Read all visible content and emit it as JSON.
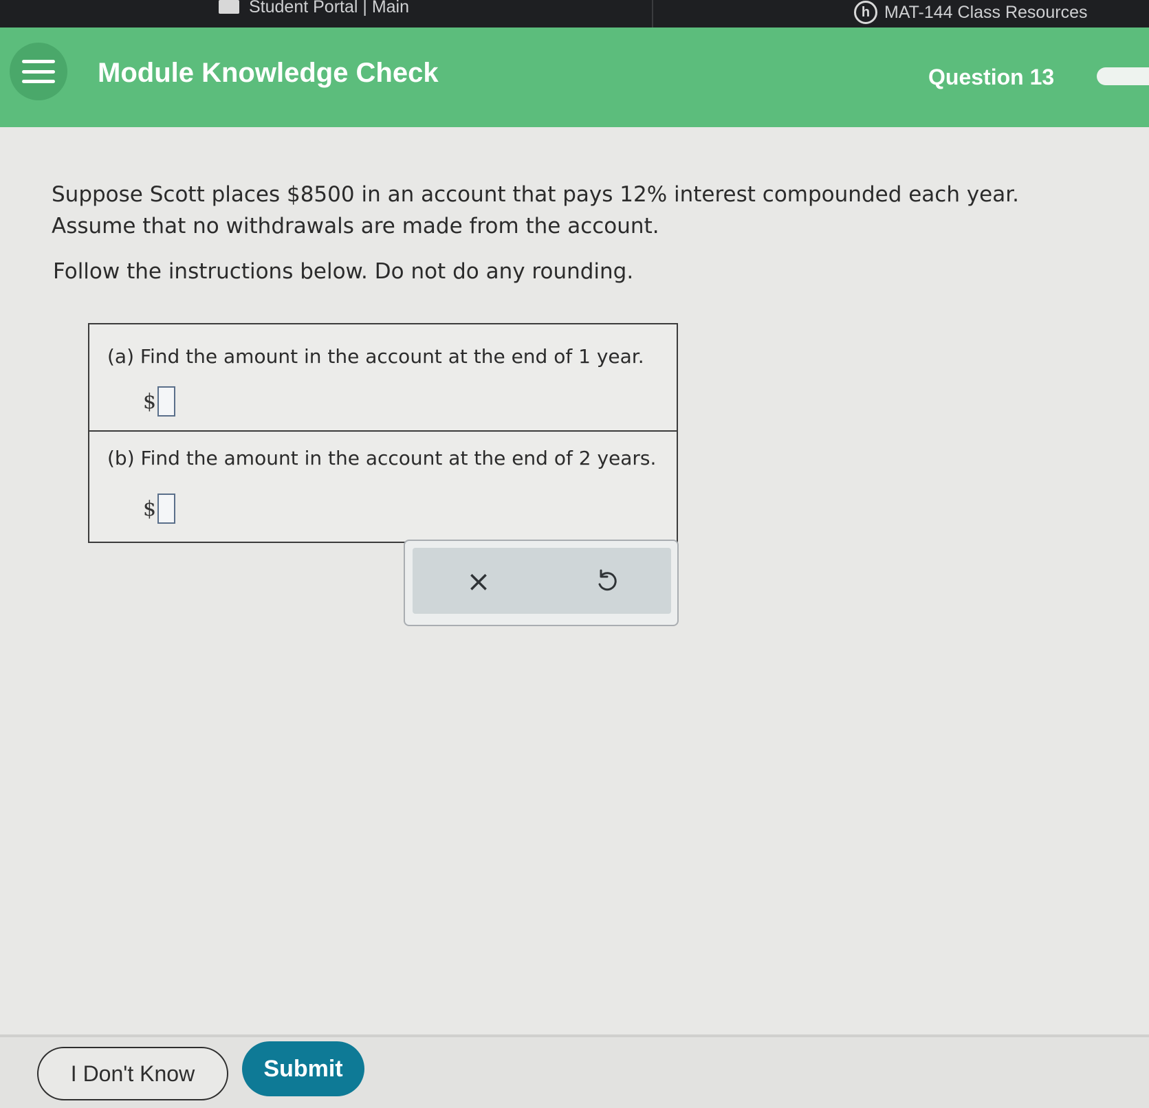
{
  "browser": {
    "tab_left": "Student Portal | Main",
    "tab_right": "MAT-144 Class Resources",
    "tab_right_icon_letter": "h"
  },
  "header": {
    "title": "Module Knowledge Check",
    "question": "Question 13",
    "accent_color": "#5cbd7c"
  },
  "problem": {
    "line1": "Suppose Scott places $8500 in an account that pays 12% interest compounded each year.",
    "line2": "Assume that no withdrawals are made from the account.",
    "instruction": "Follow the instructions below. Do not do any rounding."
  },
  "parts": [
    {
      "label": "(a) Find the amount in the account at the end of 1 year.",
      "prefix": "$",
      "value": ""
    },
    {
      "label": "(b) Find the amount in the account at the end of 2 years.",
      "prefix": "$",
      "value": ""
    }
  ],
  "tools": {
    "clear_symbol": "×",
    "clear_icon": "x-icon",
    "undo_icon": "undo-icon"
  },
  "footer": {
    "dont_know_label": "I Don't Know",
    "submit_label": "Submit",
    "submit_color": "#0e7a96"
  }
}
